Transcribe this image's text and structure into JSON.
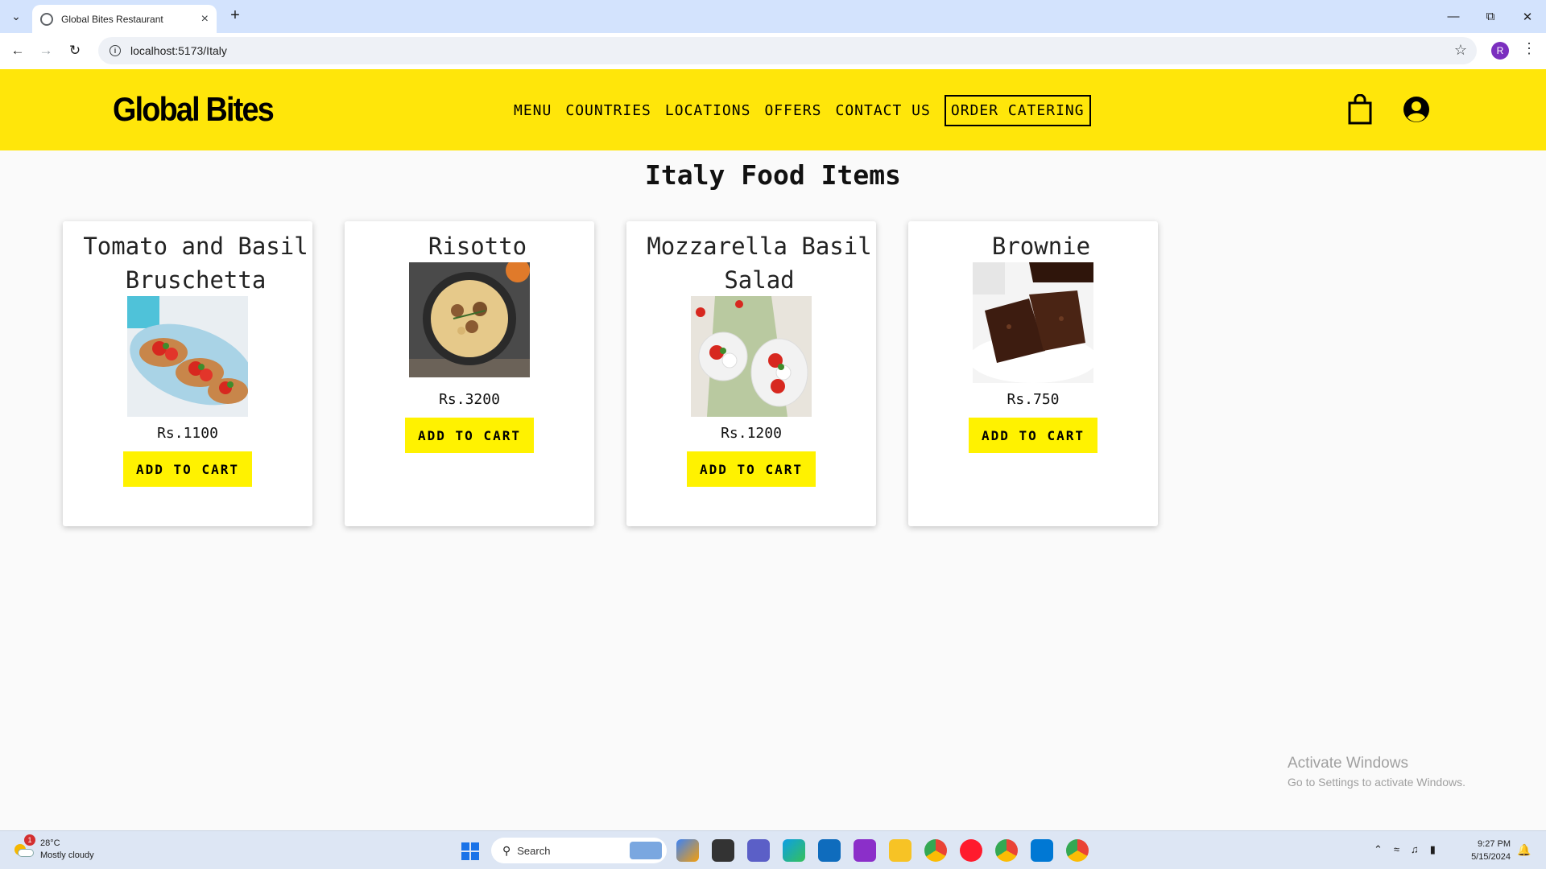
{
  "browser": {
    "tab_title": "Global Bites Restaurant",
    "url": "localhost:5173/Italy",
    "profile_initial": "R"
  },
  "site": {
    "logo": "Global Bites",
    "nav": [
      "MENU",
      "COUNTRIES",
      "LOCATIONS",
      "OFFERS",
      "CONTACT US",
      "ORDER CATERING"
    ],
    "accent_color": "#ffe60a"
  },
  "page": {
    "title": "Italy Food Items",
    "items": [
      {
        "name": "Tomato and Basil Bruschetta",
        "price": "Rs.1100",
        "button": "ADD TO CART",
        "image": "bruschetta"
      },
      {
        "name": "Risotto",
        "price": "Rs.3200",
        "button": "ADD TO CART",
        "image": "risotto"
      },
      {
        "name": "Mozzarella Basil Salad",
        "price": "Rs.1200",
        "button": "ADD TO CART",
        "image": "caprese-salad"
      },
      {
        "name": "Brownie",
        "price": "Rs.750",
        "button": "ADD TO CART",
        "image": "brownie"
      }
    ]
  },
  "watermark": {
    "line1": "Activate Windows",
    "line2": "Go to Settings to activate Windows."
  },
  "taskbar": {
    "weather_badge": "1",
    "temperature": "28°C",
    "condition": "Mostly cloudy",
    "search_placeholder": "Search",
    "time": "9:27 PM",
    "date": "5/15/2024"
  }
}
